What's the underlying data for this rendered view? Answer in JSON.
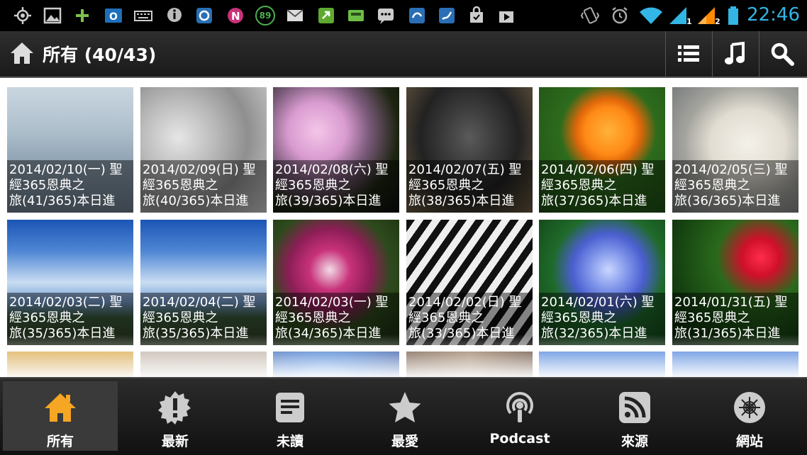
{
  "status_bar": {
    "time": "22:46",
    "badge_89": "89",
    "sim1": "1",
    "sim2": "2"
  },
  "action_bar": {
    "title": "所有 (40/43)"
  },
  "grid": {
    "rows": [
      [
        {
          "line1": "2014/02/10(一) 聖",
          "line2": "經365恩典之",
          "line3": "旅(41/365)本日進",
          "theme": "water"
        },
        {
          "line1": "2014/02/09(日) 聖",
          "line2": "經365恩典之",
          "line3": "旅(40/365)本日進",
          "theme": "wall"
        },
        {
          "line1": "2014/02/08(六) 聖",
          "line2": "經365恩典之",
          "line3": "旅(39/365)本日進",
          "theme": "pinkflower"
        },
        {
          "line1": "2014/02/07(五) 聖",
          "line2": "經365恩典之",
          "line3": "旅(38/365)本日進",
          "theme": "monkey"
        },
        {
          "line1": "2014/02/06(四) 聖",
          "line2": "經365恩典之",
          "line3": "旅(37/365)本日進",
          "theme": "poppy"
        },
        {
          "line1": "2014/02/05(三) 聖",
          "line2": "經365恩典之",
          "line3": "旅(36/365)本日進",
          "theme": "bear"
        }
      ],
      [
        {
          "line1": "2014/02/03(二) 聖",
          "line2": "經365恩典之",
          "line3": "旅(35/365)本日進",
          "theme": "sky"
        },
        {
          "line1": "2014/02/04(二) 聖",
          "line2": "經365恩典之",
          "line3": "旅(35/365)本日進",
          "theme": "sky"
        },
        {
          "line1": "2014/02/03(一) 聖",
          "line2": "經365恩典之",
          "line3": "旅(34/365)本日進",
          "theme": "petunia"
        },
        {
          "line1": "2014/02/02(日) 聖",
          "line2": "經365恩典之",
          "line3": "旅(33/365)本日進",
          "theme": "zebra"
        },
        {
          "line1": "2014/02/01(六) 聖",
          "line2": "經365恩典之",
          "line3": "旅(32/365)本日進",
          "theme": "morningglory"
        },
        {
          "line1": "2014/01/31(五) 聖",
          "line2": "經365恩典之",
          "line3": "旅(31/365)本日進",
          "theme": "redflower"
        }
      ],
      [
        {
          "theme": "autumn"
        },
        {
          "theme": "cracked"
        },
        {
          "theme": "bluelights"
        },
        {
          "theme": "wood"
        },
        {
          "theme": "bluesky"
        },
        {
          "theme": "bluesky"
        }
      ]
    ]
  },
  "tabs": [
    {
      "label": "所有",
      "icon": "home-icon",
      "active": true
    },
    {
      "label": "最新",
      "icon": "new-badge-icon",
      "active": false
    },
    {
      "label": "未讀",
      "icon": "unread-doc-icon",
      "active": false
    },
    {
      "label": "最愛",
      "icon": "star-icon",
      "active": false
    },
    {
      "label": "Podcast",
      "icon": "podcast-icon",
      "active": false
    },
    {
      "label": "來源",
      "icon": "rss-icon",
      "active": false
    },
    {
      "label": "網站",
      "icon": "web-icon",
      "active": false
    }
  ],
  "colors": {
    "accent": "#f5a623",
    "time": "#33b5e5"
  }
}
